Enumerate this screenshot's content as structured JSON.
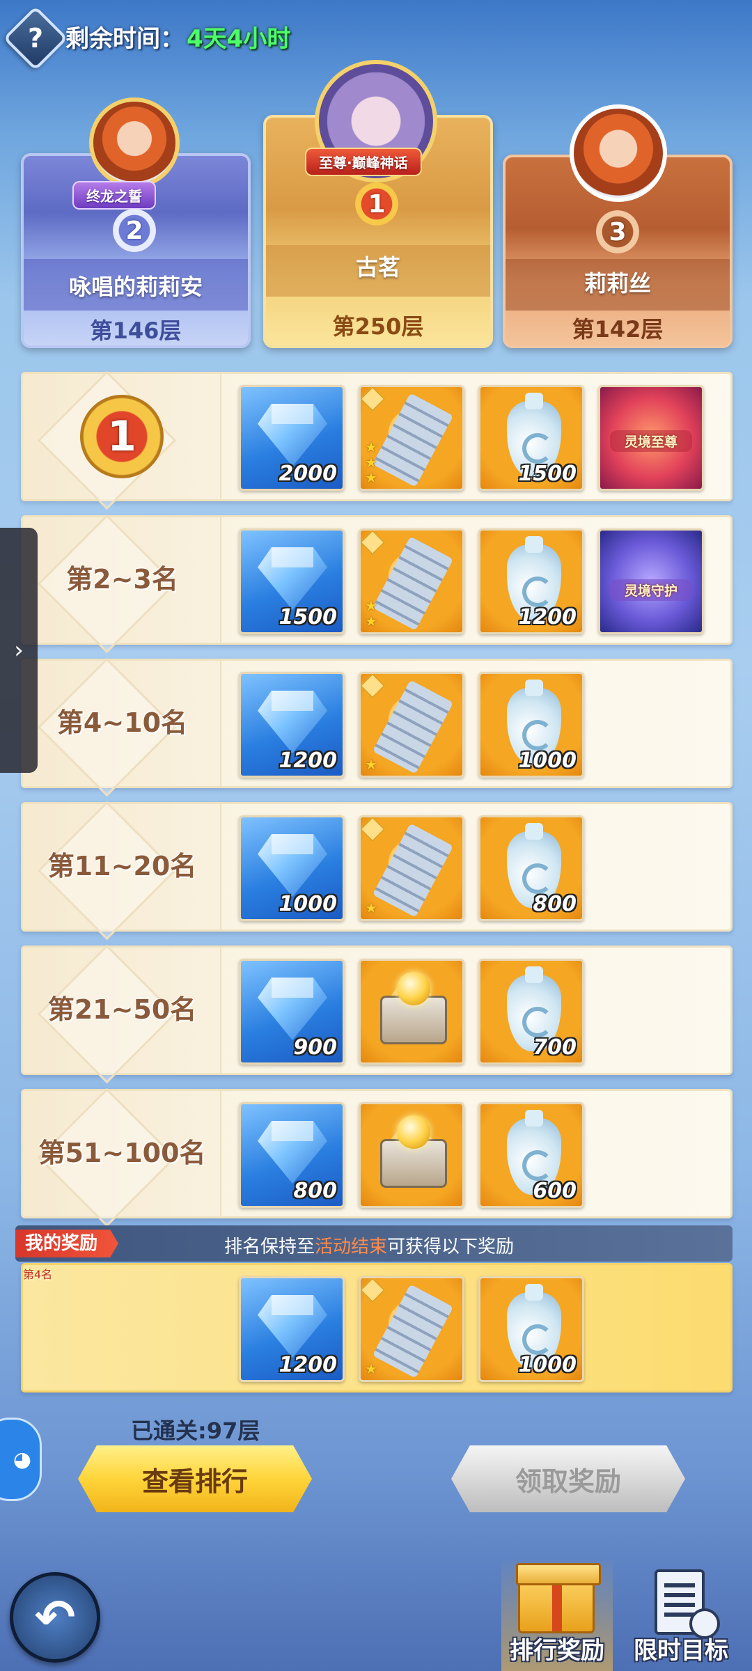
{
  "header": {
    "help_icon": "?",
    "time_label": "剩余时间：",
    "time_value": "4天4小时"
  },
  "podium": {
    "first": {
      "rank": "1",
      "name": "古茗",
      "floor": "第250层",
      "title": "至尊·巅峰神话"
    },
    "second": {
      "rank": "2",
      "name": "咏唱的莉莉安",
      "floor": "第146层",
      "title": "终龙之誓"
    },
    "third": {
      "rank": "3",
      "name": "莉莉丝",
      "floor": "第142层"
    }
  },
  "reward_rows": [
    {
      "rank_label": "1",
      "items": [
        {
          "type": "diamond",
          "qty": "2000"
        },
        {
          "type": "key",
          "stars": 3
        },
        {
          "type": "vase",
          "qty": "1500"
        },
        {
          "type": "title",
          "label": "灵境至尊"
        }
      ]
    },
    {
      "rank_label": "第2~3名",
      "items": [
        {
          "type": "diamond",
          "qty": "1500"
        },
        {
          "type": "key",
          "stars": 2
        },
        {
          "type": "vase",
          "qty": "1200"
        },
        {
          "type": "title",
          "label": "灵境守护"
        }
      ]
    },
    {
      "rank_label": "第4~10名",
      "items": [
        {
          "type": "diamond",
          "qty": "1200"
        },
        {
          "type": "key",
          "stars": 1
        },
        {
          "type": "vase",
          "qty": "1000"
        }
      ]
    },
    {
      "rank_label": "第11~20名",
      "items": [
        {
          "type": "diamond",
          "qty": "1000"
        },
        {
          "type": "key",
          "stars": 1
        },
        {
          "type": "vase",
          "qty": "800"
        }
      ]
    },
    {
      "rank_label": "第21~50名",
      "items": [
        {
          "type": "diamond",
          "qty": "900"
        },
        {
          "type": "chest"
        },
        {
          "type": "vase",
          "qty": "700"
        }
      ]
    },
    {
      "rank_label": "第51~100名",
      "items": [
        {
          "type": "diamond",
          "qty": "800"
        },
        {
          "type": "chest"
        },
        {
          "type": "vase",
          "qty": "600"
        }
      ]
    }
  ],
  "my_reward": {
    "tag": "我的奖励",
    "note_prefix": "排名保持至",
    "note_highlight": "活动结束",
    "note_suffix": "可获得以下奖励",
    "rank_label": "第4名",
    "items": [
      {
        "type": "diamond",
        "qty": "1200"
      },
      {
        "type": "key",
        "stars": 1
      },
      {
        "type": "vase",
        "qty": "1000"
      }
    ]
  },
  "progress": {
    "cleared": "已通关:97层"
  },
  "buttons": {
    "view_ranking": "查看排行",
    "claim_reward": "领取奖励"
  },
  "bottom_tabs": {
    "rank_reward": "排行奖励",
    "limited_target": "限时目标"
  },
  "icons": {
    "side_expand": "›",
    "back": "↶"
  }
}
